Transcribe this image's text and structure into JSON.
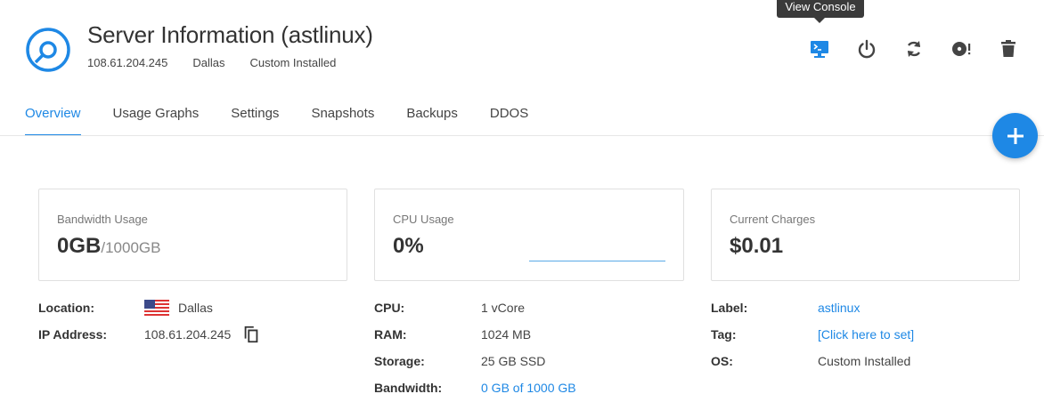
{
  "tooltip": "View Console",
  "header": {
    "title": "Server Information (astlinux)",
    "ip": "108.61.204.245",
    "location": "Dallas",
    "os": "Custom Installed"
  },
  "actions": [
    {
      "name": "view-console",
      "icon": "monitor-console-icon"
    },
    {
      "name": "power",
      "icon": "power-icon"
    },
    {
      "name": "restart",
      "icon": "refresh-icon"
    },
    {
      "name": "reinstall",
      "icon": "disc-alert-icon"
    },
    {
      "name": "delete",
      "icon": "trash-icon"
    }
  ],
  "tabs": [
    "Overview",
    "Usage Graphs",
    "Settings",
    "Snapshots",
    "Backups",
    "DDOS"
  ],
  "active_tab": "Overview",
  "cards": {
    "bandwidth": {
      "label": "Bandwidth Usage",
      "value": "0GB",
      "sub": "/1000GB"
    },
    "cpu": {
      "label": "CPU Usage",
      "value": "0%"
    },
    "charges": {
      "label": "Current Charges",
      "value": "$0.01"
    }
  },
  "info_left": {
    "location_key": "Location:",
    "location_val": "Dallas",
    "ip_key": "IP Address:",
    "ip_val": "108.61.204.245"
  },
  "info_mid": {
    "cpu_key": "CPU:",
    "cpu_val": "1 vCore",
    "ram_key": "RAM:",
    "ram_val": "1024 MB",
    "storage_key": "Storage:",
    "storage_val": "25 GB SSD",
    "bandwidth_key": "Bandwidth:",
    "bandwidth_val": "0 GB of 1000 GB"
  },
  "info_right": {
    "label_key": "Label:",
    "label_val": "astlinux",
    "tag_key": "Tag:",
    "tag_val": "[Click here to set]",
    "os_key": "OS:",
    "os_val": "Custom Installed"
  },
  "colors": {
    "accent": "#1e88e5",
    "icon": "#444444"
  }
}
